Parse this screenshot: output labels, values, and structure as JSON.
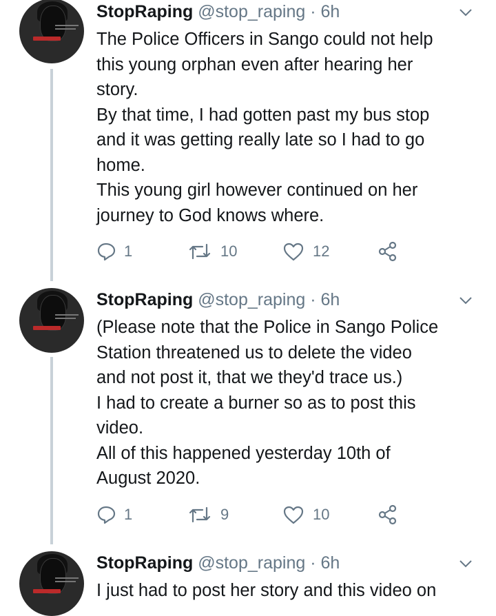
{
  "tweets": [
    {
      "name": "StopRaping",
      "handle": "@stop_raping",
      "time": "6h",
      "text": "The Police Officers in Sango could not help\nthis young orphan even after hearing her\nstory.\nBy that time, I had gotten past my bus stop\nand it was getting really late so I had to go\nhome.\nThis young girl however continued on her\njourney to God knows where.",
      "replies": "1",
      "retweets": "10",
      "likes": "12"
    },
    {
      "name": "StopRaping",
      "handle": "@stop_raping",
      "time": "6h",
      "text": "(Please note that the Police in Sango Police\nStation threatened us to delete the video\nand not post it, that we they'd trace us.)\nI had to create a burner so as to post this\nvideo.\nAll of this happened yesterday 10th of\nAugust 2020.",
      "replies": "1",
      "retweets": "9",
      "likes": "10"
    },
    {
      "name": "StopRaping",
      "handle": "@stop_raping",
      "time": "6h",
      "text": "I just had to post her story and this video on",
      "replies": "",
      "retweets": "",
      "likes": ""
    }
  ],
  "colors": {
    "text": "#14171a",
    "muted": "#657786",
    "thread": "#c8d1d8"
  },
  "icons": [
    "reply-icon",
    "retweet-icon",
    "like-icon",
    "share-icon",
    "chevron-down-icon"
  ]
}
